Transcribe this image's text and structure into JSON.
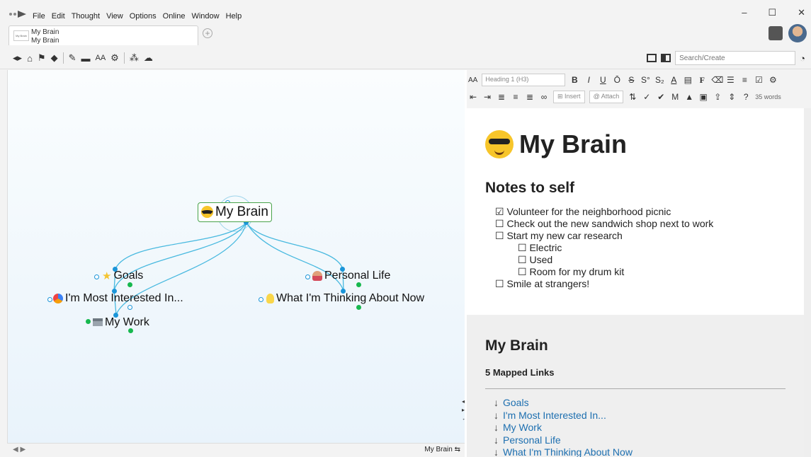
{
  "menu": [
    "File",
    "Edit",
    "Thought",
    "View",
    "Options",
    "Online",
    "Window",
    "Help"
  ],
  "tab": {
    "thumb": "My Brain",
    "line1": "My Brain",
    "line2": "My Brain"
  },
  "window_controls": {
    "minimize": "–",
    "maximize": "☐",
    "close": "✕"
  },
  "toolbar": {
    "search_placeholder": "Search/Create"
  },
  "map": {
    "central": "My Brain",
    "thoughts": [
      "Goals",
      "I'm Most Interested In...",
      "My Work",
      "Personal Life",
      "What I'm Thinking About Now"
    ],
    "status_label": "My Brain"
  },
  "notes_toolbar": {
    "heading_select": "Heading 1 (H3)",
    "insert_label": "Insert",
    "attach_label": "Attach",
    "word_count": "35 words"
  },
  "notes": {
    "title": "My Brain",
    "section": "Notes to self",
    "items": [
      {
        "checked": true,
        "text": "Volunteer for the neighborhood picnic",
        "level": 0
      },
      {
        "checked": false,
        "text": "Check out the new sandwich shop next to work",
        "level": 0
      },
      {
        "checked": false,
        "text": "Start my new car research",
        "level": 0
      },
      {
        "checked": false,
        "text": "Electric",
        "level": 1
      },
      {
        "checked": false,
        "text": "Used",
        "level": 1
      },
      {
        "checked": false,
        "text": "Room for my drum kit",
        "level": 1
      },
      {
        "checked": false,
        "text": "Smile at strangers!",
        "level": 0
      }
    ],
    "footer_title": "My Brain",
    "footer_subtitle": "5 Mapped Links",
    "links": [
      "Goals",
      "I'm Most Interested In...",
      "My Work",
      "Personal Life",
      "What I'm Thinking About Now"
    ]
  },
  "colors": {
    "link_line": "#48b9df",
    "active_border": "#48a34a",
    "link_text": "#1d6fb0"
  }
}
